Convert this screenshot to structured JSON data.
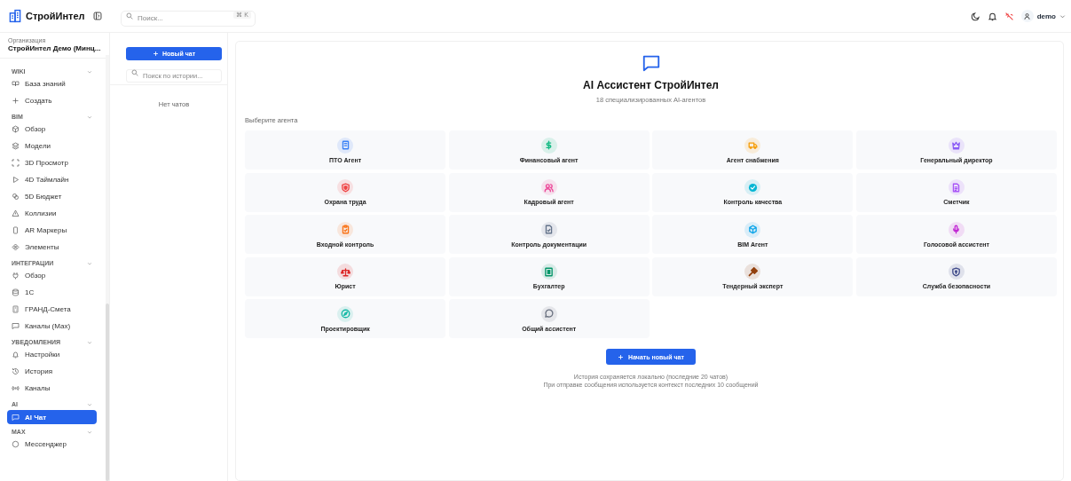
{
  "app": {
    "name": "СтройИнтел"
  },
  "search": {
    "placeholder": "Поиск...",
    "shortcut": "⌘ K"
  },
  "header": {
    "user": "demo"
  },
  "organization": {
    "label": "Организация",
    "name": "СтройИнтел Демо (Минц..."
  },
  "sidebar": {
    "sections": [
      {
        "title": "WIKI",
        "expanded": true,
        "items": [
          {
            "label": "База знаний",
            "selected": false
          },
          {
            "label": "Создать",
            "selected": false
          }
        ]
      },
      {
        "title": "BIM",
        "expanded": true,
        "items": [
          {
            "label": "Обзор",
            "selected": false
          },
          {
            "label": "Модели",
            "selected": false
          },
          {
            "label": "3D Просмотр",
            "selected": false
          },
          {
            "label": "4D Таймлайн",
            "selected": false
          },
          {
            "label": "5D Бюджет",
            "selected": false
          },
          {
            "label": "Коллизии",
            "selected": false
          },
          {
            "label": "AR Маркеры",
            "selected": false
          },
          {
            "label": "Элементы",
            "selected": false
          }
        ]
      },
      {
        "title": "ИНТЕГРАЦИИ",
        "expanded": true,
        "items": [
          {
            "label": "Обзор",
            "selected": false
          },
          {
            "label": "1С",
            "selected": false
          },
          {
            "label": "ГРАНД-Смета",
            "selected": false
          },
          {
            "label": "Каналы (Max)",
            "selected": false
          }
        ]
      },
      {
        "title": "УВЕДОМЛЕНИЯ",
        "expanded": true,
        "items": [
          {
            "label": "Настройки",
            "selected": false
          },
          {
            "label": "История",
            "selected": false
          },
          {
            "label": "Каналы",
            "selected": false
          }
        ]
      },
      {
        "title": "AI",
        "expanded": true,
        "items": [
          {
            "label": "AI Чат",
            "selected": true
          }
        ]
      },
      {
        "title": "MAX",
        "expanded": true,
        "items": [
          {
            "label": "Мессенджер",
            "selected": false
          }
        ]
      }
    ]
  },
  "chat_list": {
    "new_chat_button": "Новый чат",
    "search_placeholder": "Поиск по истории...",
    "empty_text": "Нет чатов"
  },
  "main": {
    "title": "AI Ассистент СтройИнтел",
    "subtitle": "18 специализированных AI-агентов",
    "choose_label": "Выберите агента",
    "agents": [
      {
        "name": "ПТО Агент",
        "color": "#3b82f6"
      },
      {
        "name": "Финансовый агент",
        "color": "#10b981"
      },
      {
        "name": "Агент снабжения",
        "color": "#f59e0b"
      },
      {
        "name": "Генеральный директор",
        "color": "#8b5cf6"
      },
      {
        "name": "Охрана труда",
        "color": "#ef4444"
      },
      {
        "name": "Кадровый агент",
        "color": "#ec4899"
      },
      {
        "name": "Контроль качества",
        "color": "#06b6d4"
      },
      {
        "name": "Сметчик",
        "color": "#a855f7"
      },
      {
        "name": "Входной контроль",
        "color": "#f97316"
      },
      {
        "name": "Контроль документации",
        "color": "#64748b"
      },
      {
        "name": "BIM Агент",
        "color": "#0ea5e9"
      },
      {
        "name": "Голосовой ассистент",
        "color": "#c026d3"
      },
      {
        "name": "Юрист",
        "color": "#dc2626"
      },
      {
        "name": "Бухгалтер",
        "color": "#059669"
      },
      {
        "name": "Тендерный эксперт",
        "color": "#92400e"
      },
      {
        "name": "Служба безопасности",
        "color": "#3f4a8a"
      },
      {
        "name": "Проектировщик",
        "color": "#14b8a6"
      },
      {
        "name": "Общий ассистент",
        "color": "#6b7280"
      }
    ],
    "start_button": "Начать новый чат",
    "notes": [
      "История сохраняется локально (последние 20 чатов)",
      "При отправке сообщения используется контекст последних 10 сообщений"
    ]
  }
}
